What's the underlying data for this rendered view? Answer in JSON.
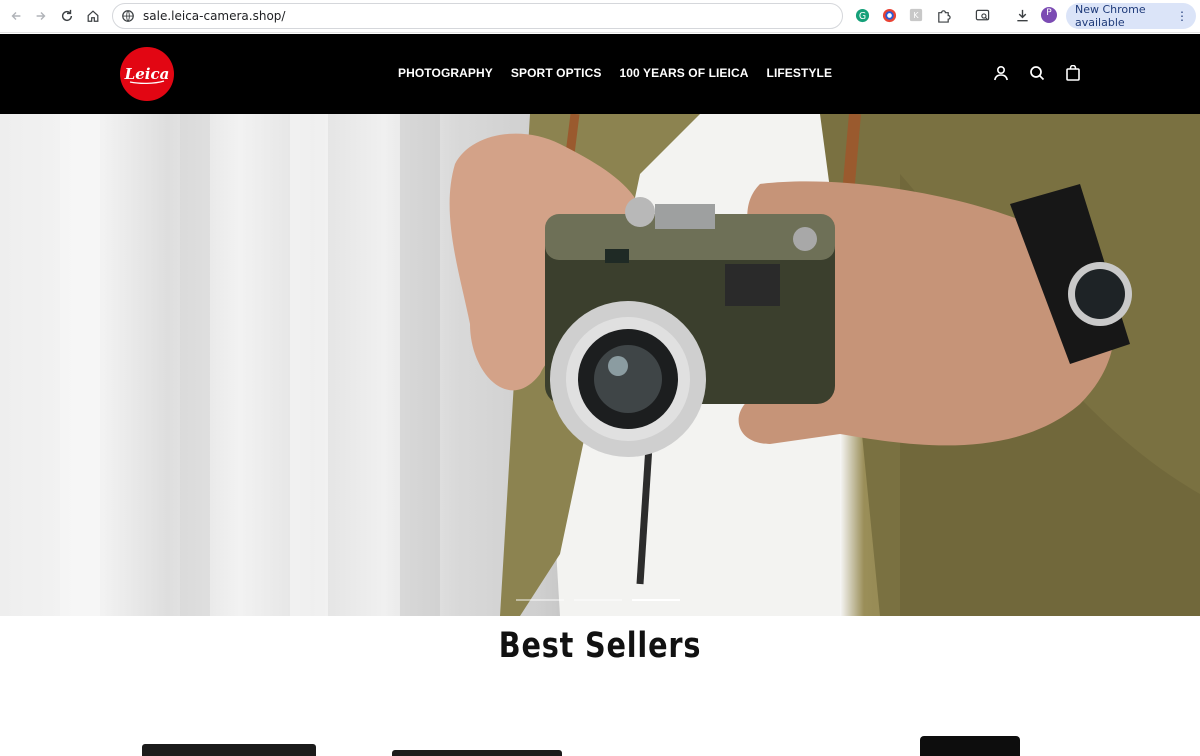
{
  "browser": {
    "url": "sale.leica-camera.shop/",
    "update_label": "New Chrome available",
    "profile_initial": "P"
  },
  "header": {
    "logo_text": "Leica",
    "nav": [
      {
        "label": "PHOTOGRAPHY"
      },
      {
        "label": "SPORT OPTICS"
      },
      {
        "label": "100 YEARS OF LIEICA"
      },
      {
        "label": "LIFESTYLE"
      }
    ],
    "icons": [
      "account-icon",
      "search-icon",
      "cart-icon"
    ]
  },
  "hero": {
    "slides_total": 3,
    "active_slide": 3
  },
  "best_sellers": {
    "title": "Best Sellers"
  },
  "colors": {
    "header_bg": "#000000",
    "logo_red": "#e20613",
    "update_pill": "#dbe4f8"
  }
}
